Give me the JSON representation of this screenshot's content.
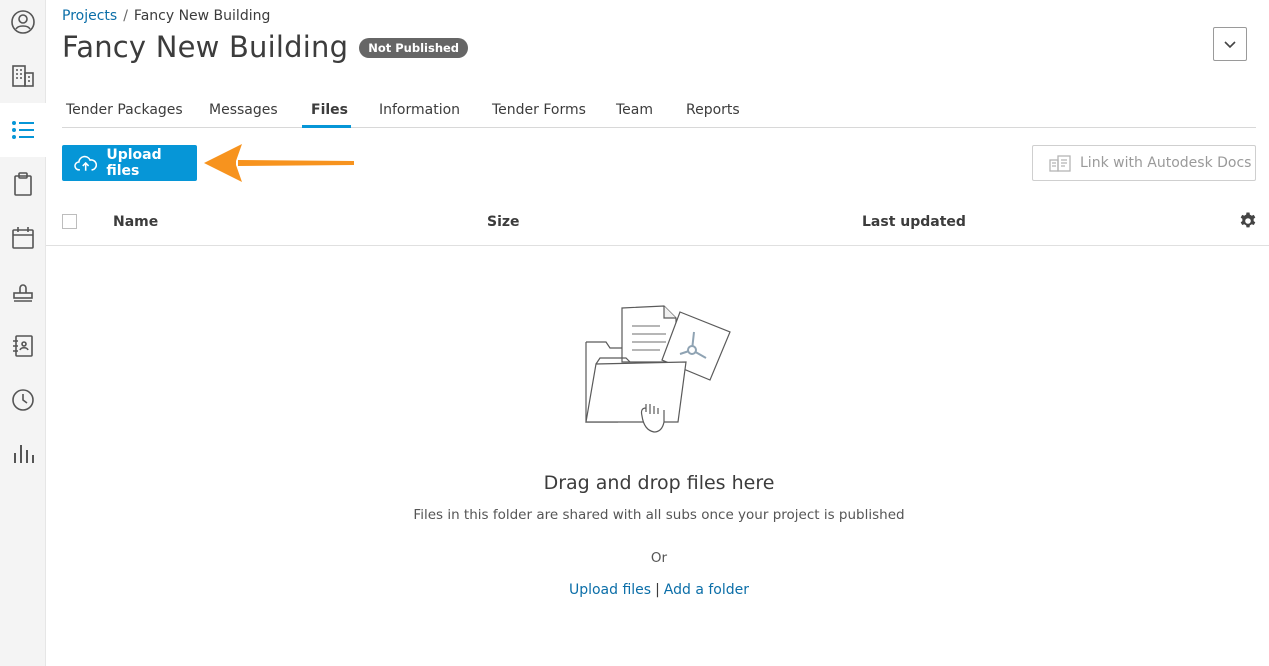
{
  "breadcrumb": {
    "root": "Projects",
    "separator": "/",
    "current": "Fancy New Building"
  },
  "project": {
    "title": "Fancy New Building",
    "status": "Not Published"
  },
  "tabs": [
    {
      "label": "Tender Packages"
    },
    {
      "label": "Messages"
    },
    {
      "label": "Files"
    },
    {
      "label": "Information"
    },
    {
      "label": "Tender Forms"
    },
    {
      "label": "Team"
    },
    {
      "label": "Reports"
    }
  ],
  "active_tab": "Files",
  "toolbar": {
    "upload_label": "Upload files",
    "autodesk_label": "Link with Autodesk Docs"
  },
  "table": {
    "columns": [
      "Name",
      "Size",
      "Last updated"
    ]
  },
  "empty_state": {
    "title": "Drag and drop files here",
    "subtitle": "Files in this folder are shared with all subs once your project is published",
    "or": "Or",
    "upload_link": "Upload files",
    "pipe": "|",
    "folder_link": "Add a folder"
  },
  "colors": {
    "accent": "#0696d7",
    "link": "#0b6ea8",
    "arrow": "#f7931e",
    "badge": "#666666"
  },
  "sidebar_icons": [
    "profile-icon",
    "building-icon",
    "list-icon",
    "clipboard-icon",
    "calendar-icon",
    "stamp-icon",
    "address-book-icon",
    "clock-icon",
    "bar-chart-icon"
  ]
}
